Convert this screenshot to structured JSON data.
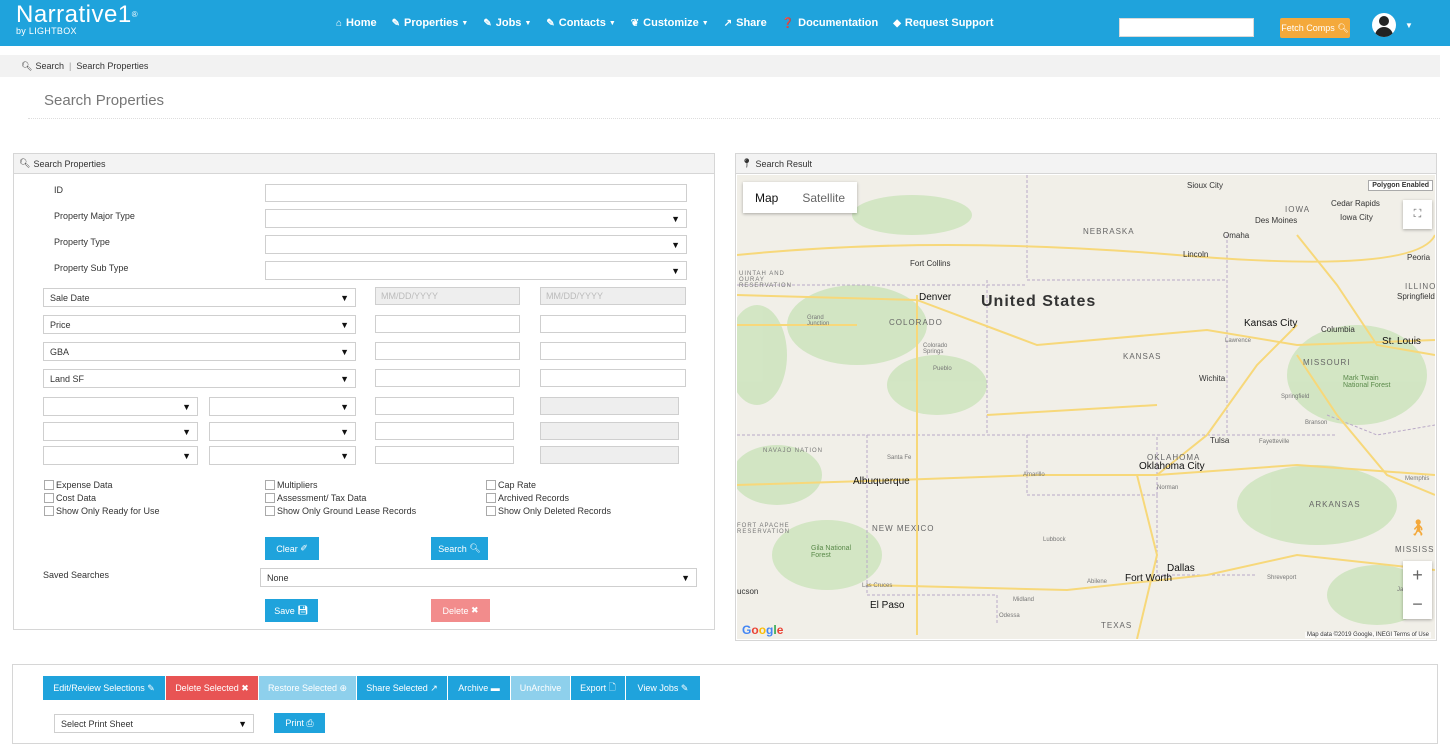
{
  "brand": {
    "name": "Narrative1",
    "trademark": "®",
    "sub": "by LIGHTBOX"
  },
  "nav": {
    "items": [
      {
        "label": "Home",
        "icon": "home-icon",
        "dropdown": false
      },
      {
        "label": "Properties",
        "icon": "edit-icon",
        "dropdown": true
      },
      {
        "label": "Jobs",
        "icon": "edit-icon",
        "dropdown": true
      },
      {
        "label": "Contacts",
        "icon": "edit-icon",
        "dropdown": true
      },
      {
        "label": "Customize",
        "icon": "leaf-icon",
        "dropdown": true
      },
      {
        "label": "Share",
        "icon": "share-icon",
        "dropdown": false
      },
      {
        "label": "Documentation",
        "icon": "question-icon",
        "dropdown": false
      },
      {
        "label": "Request Support",
        "icon": "tag-icon",
        "dropdown": false
      }
    ],
    "search_value": "",
    "fetch_label": "Fetch Comps"
  },
  "breadcrumb": {
    "root": "Search",
    "separator": "|",
    "current": "Search Properties"
  },
  "page_title": "Search Properties",
  "search_panel": {
    "title": "Search Properties",
    "id_label": "ID",
    "id_value": "",
    "major_type_label": "Property Major Type",
    "major_type_value": "",
    "type_label": "Property Type",
    "type_value": "",
    "sub_type_label": "Property Sub Type",
    "sub_type_value": "",
    "range_rows": [
      {
        "field": "Sale Date",
        "from_placeholder": "MM/DD/YYYY",
        "to_placeholder": "MM/DD/YYYY"
      },
      {
        "field": "Price",
        "from_placeholder": "",
        "to_placeholder": ""
      },
      {
        "field": "GBA",
        "from_placeholder": "",
        "to_placeholder": ""
      },
      {
        "field": "Land SF",
        "from_placeholder": "",
        "to_placeholder": ""
      }
    ],
    "checkboxes": {
      "col1": [
        "Expense Data",
        "Cost Data",
        "Show Only Ready for Use"
      ],
      "col2": [
        "Multipliers",
        "Assessment/ Tax Data",
        "Show Only Ground Lease Records"
      ],
      "col3": [
        "Cap Rate",
        "Archived Records",
        "Show Only Deleted Records"
      ]
    },
    "clear_label": "Clear",
    "search_label": "Search",
    "saved_searches_label": "Saved Searches",
    "saved_searches_value": "None",
    "save_label": "Save",
    "delete_label": "Delete"
  },
  "map_panel": {
    "title": "Search Result",
    "map_tab": "Map",
    "satellite_tab": "Satellite",
    "polygon_label": "Polygon Enabled",
    "attribution": "Map data ©2019 Google, INEGI   Terms of Use",
    "google": "Google",
    "country": "United States",
    "states": [
      "NEBRASKA",
      "IOWA",
      "COLORADO",
      "KANSAS",
      "MISSOURI",
      "OKLAHOMA",
      "ARKANSAS",
      "NEW MEXICO",
      "TEXAS",
      "ILLINOI",
      "MISSISSIP"
    ],
    "cities_big": [
      "Denver",
      "Kansas City",
      "St. Louis",
      "Oklahoma City",
      "Albuquerque",
      "Dallas",
      "Fort Worth",
      "El Paso"
    ],
    "cities": [
      "Sioux City",
      "Cedar Rapids",
      "Des Moines",
      "Iowa City",
      "Omaha",
      "Lincoln",
      "Peoria",
      "Springfield",
      "Fort Collins",
      "Grand Junction",
      "Colorado Springs",
      "Pueblo",
      "Lawrence",
      "Columbia",
      "Wichita",
      "Springfield",
      "Mark Twain National Forest",
      "Branson",
      "Tulsa",
      "Fayetteville",
      "Santa Fe",
      "Amarillo",
      "Norman",
      "Memphis",
      "Lubbock",
      "Gila National Forest",
      "Las Cruces",
      "Midland",
      "Odessa",
      "Abilene",
      "Shreveport",
      "Jack",
      "ucson"
    ],
    "regions": [
      "UINTAH AND OURAY RESERVATION",
      "NAVAJO NATION",
      "FORT APACHE RESERVATION"
    ]
  },
  "toolbar": {
    "buttons": [
      {
        "label": "Edit/Review Selections",
        "icon": "edit-icon",
        "color": "#1fa3dc"
      },
      {
        "label": "Delete Selected",
        "icon": "close-icon",
        "color": "#e85454"
      },
      {
        "label": "Restore Selected",
        "icon": "plus-circle-icon",
        "color": "#8ed0ec"
      },
      {
        "label": "Share Selected",
        "icon": "share-icon",
        "color": "#1fa3dc"
      },
      {
        "label": "Archive",
        "icon": "archive-icon",
        "color": "#1fa3dc"
      },
      {
        "label": "UnArchive",
        "icon": "",
        "color": "#8ed0ec"
      },
      {
        "label": "Export",
        "icon": "file-icon",
        "color": "#1fa3dc"
      },
      {
        "label": "View Jobs",
        "icon": "edit-icon",
        "color": "#1fa3dc"
      }
    ],
    "print_sheet_value": "Select Print Sheet",
    "print_label": "Print"
  },
  "colors": {
    "brand": "#1fa3dc",
    "fetch": "#f4a93b",
    "delete": "#f28c8c",
    "danger": "#e85454",
    "muted": "#8ed0ec"
  }
}
